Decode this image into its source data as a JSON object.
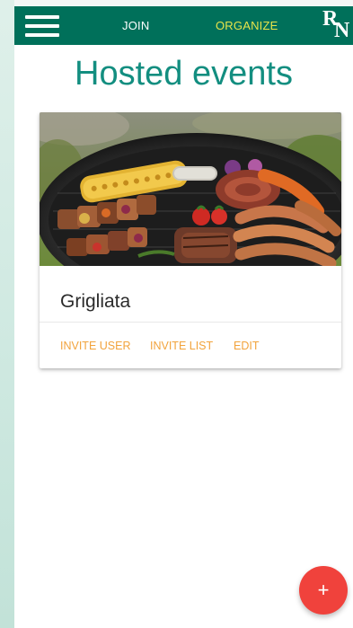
{
  "navbar": {
    "join_label": "JOIN",
    "organize_label": "ORGANIZE",
    "logo_letter_1": "R",
    "logo_letter_2": "N",
    "menu_icon": "hamburger-menu-icon"
  },
  "page": {
    "title": "Hosted events"
  },
  "events": [
    {
      "title": "Grigliata",
      "image": "grilled-food-photo",
      "actions": {
        "invite_user": "INVITE USER",
        "invite_list": "INVITE LIST",
        "edit": "EDIT"
      }
    }
  ],
  "fab": {
    "label": "+",
    "icon": "add-icon"
  },
  "colors": {
    "navbar_bg": "#00705a",
    "active_nav": "#e8e34a",
    "title": "#138e80",
    "action": "#f2a33c",
    "fab": "#f0423c",
    "side_bg": "#cfe9e1"
  }
}
